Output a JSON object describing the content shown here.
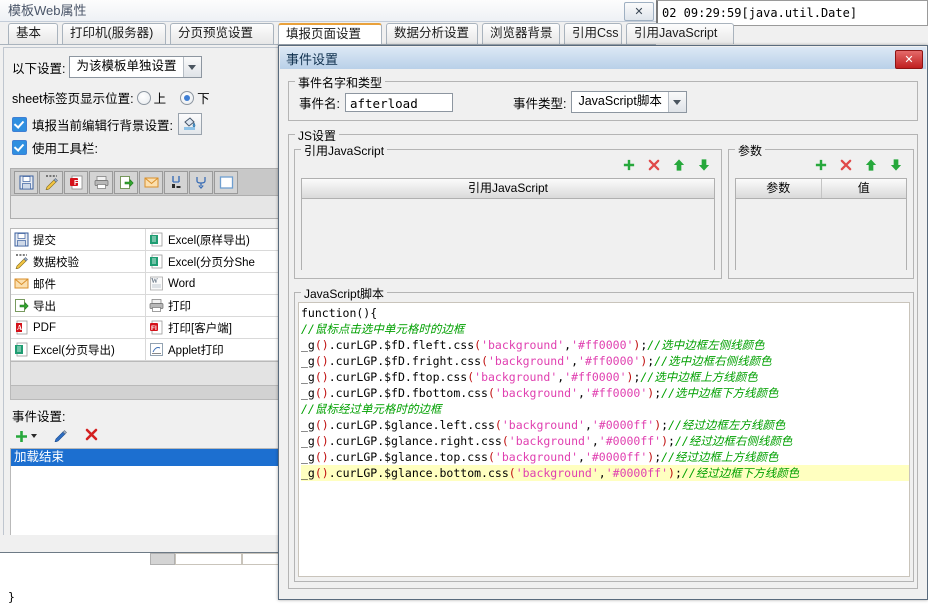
{
  "window": {
    "title": "模板Web属性",
    "close_label": "✕",
    "java_date": "02 09:29:59[java.util.Date]"
  },
  "tabs": [
    {
      "label": "基本",
      "selected": false
    },
    {
      "label": "打印机(服务器)",
      "selected": false
    },
    {
      "label": "分页预览设置",
      "selected": false
    },
    {
      "label": "填报页面设置",
      "selected": true
    },
    {
      "label": "数据分析设置",
      "selected": false
    },
    {
      "label": "浏览器背景",
      "selected": false
    },
    {
      "label": "引用Css",
      "selected": false
    },
    {
      "label": "引用JavaScript",
      "selected": false
    }
  ],
  "left_panel": {
    "settings_label": "以下设置:",
    "settings_value": "为该模板单独设置",
    "sheet_pos_label": "sheet标签页显示位置:",
    "radio_top": "上",
    "radio_bottom": "下",
    "radio_selected": "下",
    "fill_row_bg_label": "填报当前编辑行背景设置:",
    "use_toolbar_label": "使用工具栏:",
    "toolbar_icons": [
      "save-icon",
      "validate-icon",
      "flash-print-icon",
      "print-icon",
      "export-icon",
      "mail-icon",
      "page-break-icon",
      "append-icon",
      "blank-icon"
    ],
    "icon_list": [
      {
        "label": "提交",
        "icon": "save-icon"
      },
      {
        "label": "Excel(原样导出)",
        "icon": "excel-icon"
      },
      {
        "label": "数据校验",
        "icon": "validate-icon"
      },
      {
        "label": "Excel(分页分She",
        "icon": "excel-icon"
      },
      {
        "label": "邮件",
        "icon": "mail-icon"
      },
      {
        "label": "Word",
        "icon": "word-icon"
      },
      {
        "label": "导出",
        "icon": "export-icon"
      },
      {
        "label": "打印",
        "icon": "print-icon"
      },
      {
        "label": "PDF",
        "icon": "pdf-icon"
      },
      {
        "label": "打印[客户端]",
        "icon": "flash-print-icon"
      },
      {
        "label": "Excel(分页导出)",
        "icon": "excel-icon"
      },
      {
        "label": "Applet打印",
        "icon": "applet-icon"
      }
    ],
    "event_settings_label": "事件设置:",
    "event_tools": [
      "add-icon",
      "edit-icon",
      "delete-icon"
    ],
    "event_items": [
      {
        "label": "加载结束",
        "selected": true
      }
    ]
  },
  "dialog": {
    "title": "事件设置",
    "close_label": "✕",
    "group_name_type": "事件名字和类型",
    "event_name_label": "事件名:",
    "event_name_value": "afterload",
    "event_type_label": "事件类型:",
    "event_type_value": "JavaScript脚本",
    "group_js": "JS设置",
    "group_ref_js": "引用JavaScript",
    "ref_table_header": "引用JavaScript",
    "ref_table_rows": [],
    "group_params": "参数",
    "param_table_headers": [
      "参数",
      "值"
    ],
    "param_table_rows": [],
    "toolbar_icons": [
      "add-icon",
      "delete-icon",
      "up-icon",
      "down-icon"
    ],
    "group_code": "JavaScript脚本",
    "code_lines": [
      {
        "type": "plain",
        "text": "function(){",
        "highlight": false
      },
      {
        "type": "comment",
        "text": "//鼠标点击选中单元格时的边框",
        "highlight": false
      },
      {
        "type": "code",
        "prefix": "_g",
        "call": "().curLGP.$fD.fleft.css(",
        "arg1": "'background'",
        "arg2": "'#ff0000'",
        "suffix": ");",
        "comment": "//选中边框左侧线颜色",
        "highlight": false
      },
      {
        "type": "code",
        "prefix": "_g",
        "call": "().curLGP.$fD.fright.css(",
        "arg1": "'background'",
        "arg2": "'#ff0000'",
        "suffix": ");",
        "comment": "//选中边框右侧线颜色",
        "highlight": false
      },
      {
        "type": "code",
        "prefix": "_g",
        "call": "().curLGP.$fD.ftop.css(",
        "arg1": "'background'",
        "arg2": "'#ff0000'",
        "suffix": ");",
        "comment": "//选中边框上方线颜色",
        "highlight": false
      },
      {
        "type": "code",
        "prefix": "_g",
        "call": "().curLGP.$fD.fbottom.css(",
        "arg1": "'background'",
        "arg2": "'#ff0000'",
        "suffix": ");",
        "comment": "//选中边框下方线颜色",
        "highlight": false
      },
      {
        "type": "comment",
        "text": "//鼠标经过单元格时的边框",
        "highlight": false
      },
      {
        "type": "code",
        "prefix": "_g",
        "call": "().curLGP.$glance.left.css(",
        "arg1": "'background'",
        "arg2": "'#0000ff'",
        "suffix": ");",
        "comment": "//经过边框左方线颜色",
        "highlight": false
      },
      {
        "type": "code",
        "prefix": "_g",
        "call": "().curLGP.$glance.right.css(",
        "arg1": "'background'",
        "arg2": "'#0000ff'",
        "suffix": ");",
        "comment": "//经过边框右侧线颜色",
        "highlight": false
      },
      {
        "type": "code",
        "prefix": "_g",
        "call": "().curLGP.$glance.top.css(",
        "arg1": "'background'",
        "arg2": "'#0000ff'",
        "suffix": ");",
        "comment": "//经过边框上方线颜色",
        "highlight": false
      },
      {
        "type": "code",
        "prefix": "_g",
        "call": "().curLGP.$glance.bottom.css(",
        "arg1": "'background'",
        "arg2": "'#0000ff'",
        "suffix": ");",
        "comment": "//经过边框下方线颜色",
        "highlight": true
      }
    ],
    "code_tail": "}"
  },
  "colors": {
    "selection_blue": "#1c6fd0",
    "tab_accent": "#e9a13b",
    "comment_green": "#00a000",
    "string_magenta": "#e040b0",
    "paren_red": "#c01010",
    "highlight_yellow": "#ffffc0",
    "close_red": "#c01f1f"
  }
}
